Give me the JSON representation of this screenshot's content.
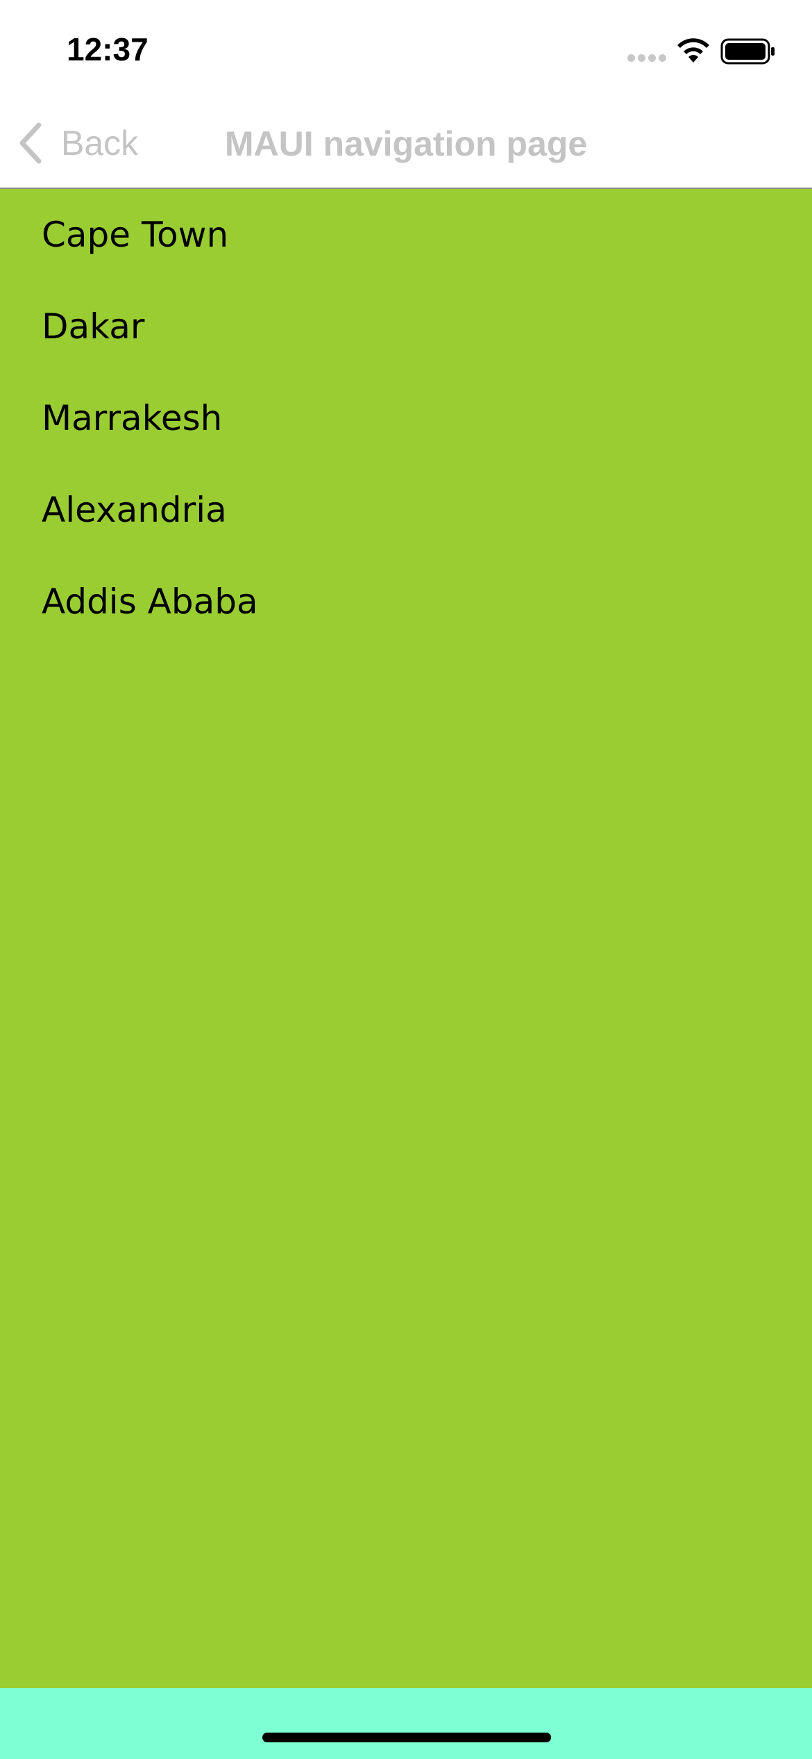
{
  "status_bar": {
    "time": "12:37",
    "icons": [
      "signal-dots-icon",
      "wifi-icon",
      "battery-icon"
    ]
  },
  "nav_bar": {
    "back_label": "Back",
    "title": "MAUI navigation page",
    "text_color": "#c4c4c4"
  },
  "content": {
    "background_color": "#9acd32",
    "cities": [
      "Cape Town",
      "Dakar",
      "Marrakesh",
      "Alexandria",
      "Addis Ababa"
    ]
  },
  "bottom_area": {
    "background_color": "#7fffd4"
  }
}
